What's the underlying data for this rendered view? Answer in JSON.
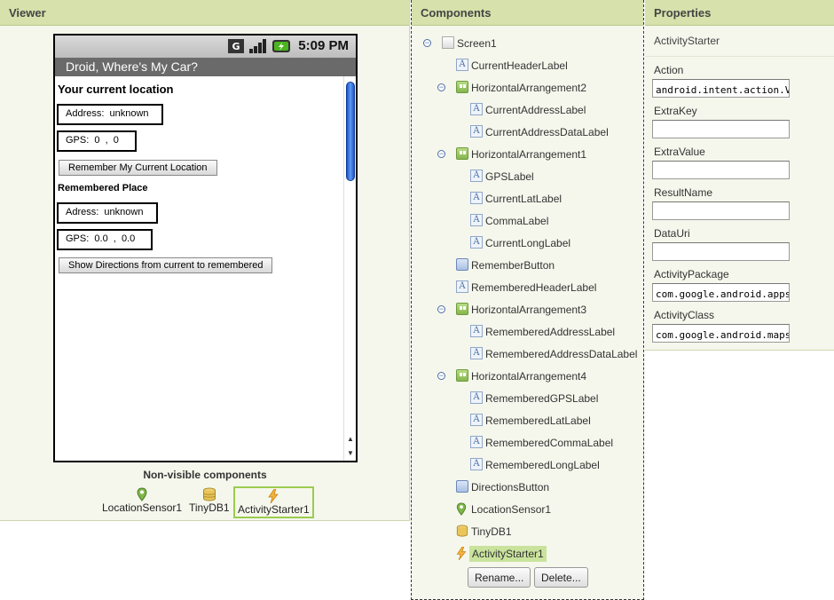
{
  "panels": {
    "viewer_title": "Viewer",
    "components_title": "Components",
    "properties_title": "Properties"
  },
  "phone": {
    "status_time": "5:09 PM",
    "app_title": "Droid, Where's My Car?",
    "current_header": "Your current location",
    "address_row": "Address:  unknown",
    "gps_row": "GPS:  0  ,  0",
    "remember_button": "Remember My Current Location",
    "remembered_header": "Remembered Place",
    "remembered_address_row": "Adress:  unknown",
    "remembered_gps_row": "GPS:  0.0  ,  0.0",
    "directions_button": "Show Directions from current to remembered"
  },
  "nonvisible": {
    "title": "Non-visible components",
    "items": [
      "LocationSensor1",
      "TinyDB1",
      "ActivityStarter1"
    ]
  },
  "components": {
    "tree": [
      {
        "label": "Screen1",
        "icon": "screen-icon"
      },
      {
        "label": "CurrentHeaderLabel",
        "icon": "label-icon"
      },
      {
        "label": "HorizontalArrangement2",
        "icon": "horizontal-arrangement-icon"
      },
      {
        "label": "CurrentAddressLabel",
        "icon": "label-icon"
      },
      {
        "label": "CurrentAddressDataLabel",
        "icon": "label-icon"
      },
      {
        "label": "HorizontalArrangement1",
        "icon": "horizontal-arrangement-icon"
      },
      {
        "label": "GPSLabel",
        "icon": "label-icon"
      },
      {
        "label": "CurrentLatLabel",
        "icon": "label-icon"
      },
      {
        "label": "CommaLabel",
        "icon": "label-icon"
      },
      {
        "label": "CurrentLongLabel",
        "icon": "label-icon"
      },
      {
        "label": "RememberButton",
        "icon": "button-icon"
      },
      {
        "label": "RememberedHeaderLabel",
        "icon": "label-icon"
      },
      {
        "label": "HorizontalArrangement3",
        "icon": "horizontal-arrangement-icon"
      },
      {
        "label": "RememberedAddressLabel",
        "icon": "label-icon"
      },
      {
        "label": "RememberedAddressDataLabel",
        "icon": "label-icon"
      },
      {
        "label": "HorizontalArrangement4",
        "icon": "horizontal-arrangement-icon"
      },
      {
        "label": "RememberedGPSLabel",
        "icon": "label-icon"
      },
      {
        "label": "RememberedLatLabel",
        "icon": "label-icon"
      },
      {
        "label": "RememberedCommaLabel",
        "icon": "label-icon"
      },
      {
        "label": "RememberedLongLabel",
        "icon": "label-icon"
      },
      {
        "label": "DirectionsButton",
        "icon": "button-icon"
      },
      {
        "label": "LocationSensor1",
        "icon": "location-pin-icon"
      },
      {
        "label": "TinyDB1",
        "icon": "database-icon"
      },
      {
        "label": "ActivityStarter1",
        "icon": "lightning-icon",
        "selected": true
      }
    ],
    "rename_button": "Rename...",
    "delete_button": "Delete..."
  },
  "properties": {
    "component_name": "ActivityStarter",
    "fields": [
      {
        "label": "Action",
        "value": "android.intent.action.VIEW"
      },
      {
        "label": "ExtraKey",
        "value": ""
      },
      {
        "label": "ExtraValue",
        "value": ""
      },
      {
        "label": "ResultName",
        "value": ""
      },
      {
        "label": "DataUri",
        "value": ""
      },
      {
        "label": "ActivityPackage",
        "value": "com.google.android.apps.maps"
      },
      {
        "label": "ActivityClass",
        "value": "com.google.android.maps.MapsActivity"
      }
    ]
  },
  "colors": {
    "header_bg": "#d6e1ab",
    "panel_bg": "#f5f7ec",
    "selection": "#c9e39c",
    "nonvisible_selected_border": "#9bcc4f"
  }
}
